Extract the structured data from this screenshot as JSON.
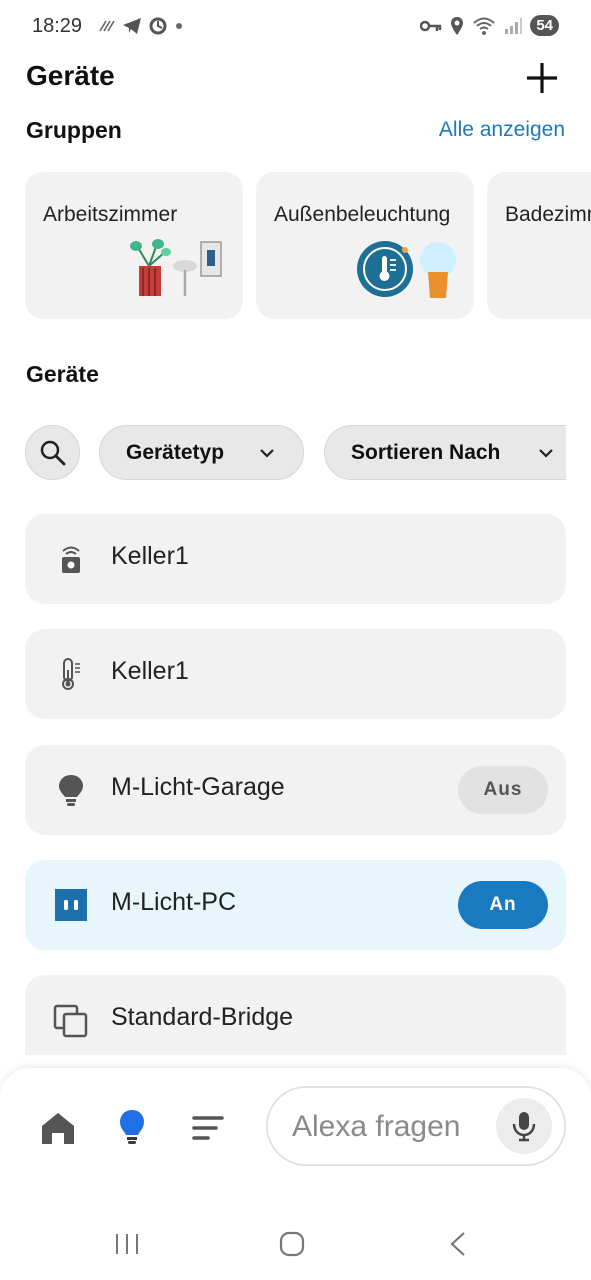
{
  "status_bar": {
    "time": "18:29",
    "battery": "54"
  },
  "header": {
    "title": "Geräte"
  },
  "groups_section": {
    "title": "Gruppen",
    "view_all": "Alle anzeigen",
    "cards": [
      {
        "name": "Arbeitszimmer"
      },
      {
        "name": "Außenbeleuchtung"
      },
      {
        "name": "Badezimmer"
      }
    ]
  },
  "devices_section": {
    "title": "Geräte",
    "filters": {
      "device_type": "Gerätetyp",
      "sort_by": "Sortieren Nach"
    },
    "items": [
      {
        "name": "Keller1",
        "icon": "security-camera-icon"
      },
      {
        "name": "Keller1",
        "icon": "thermometer-icon"
      },
      {
        "name": "M-Licht-Garage",
        "icon": "bulb-icon",
        "state": "Aus"
      },
      {
        "name": "M-Licht-PC",
        "icon": "switch-plug-icon",
        "state": "An"
      },
      {
        "name": "Standard-Bridge",
        "icon": "bridge-icon"
      }
    ]
  },
  "bottom_nav": {
    "alexa_placeholder": "Alexa fragen"
  },
  "colors": {
    "accent": "#1a7ac0",
    "card_bg": "#f2f2f2",
    "active_bg": "#e6f6fb"
  }
}
